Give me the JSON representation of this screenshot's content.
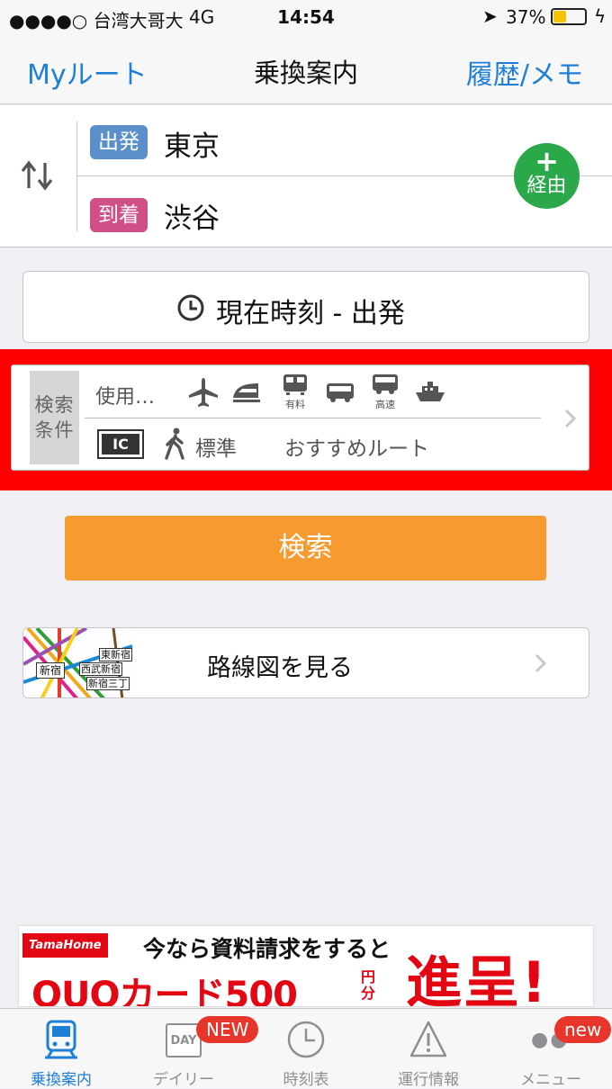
{
  "status": {
    "carrier": "●●●●○ 台湾大哥大",
    "network": "4G",
    "time": "14:54",
    "battery": "37%"
  },
  "nav": {
    "left": "Myルート",
    "title": "乗換案内",
    "right": "履歴/メモ"
  },
  "route": {
    "from_tag": "出発",
    "from_station": "東京",
    "to_tag": "到着",
    "to_station": "渋谷",
    "via_plus": "+",
    "via_label": "経由"
  },
  "time_button": "現在時刻 - 出発",
  "conditions": {
    "label": "検索条件",
    "usage": "使用…",
    "transport_icons": [
      "airplane-icon",
      "shinkansen-icon",
      "limited-express-icon",
      "bus-icon",
      "highway-bus-icon",
      "ferry-icon"
    ],
    "paid_label": "有料",
    "highway_label": "高速",
    "ic_label": "IC",
    "walk_speed": "標準",
    "route_pref": "おすすめルート"
  },
  "search_button": "検索",
  "map_button": {
    "label": "路線図を見る",
    "thumb": [
      "東新宿",
      "新宿",
      "西武新宿",
      "新宿三丁"
    ]
  },
  "ad": {
    "brand": "TamaHome",
    "line1": "今なら資料請求をすると",
    "line2": "QUOカード500",
    "unit": "円分",
    "line3": "進呈!"
  },
  "tabs": [
    {
      "label": "乗換案内",
      "icon": "train-icon",
      "badge": ""
    },
    {
      "label": "デイリー",
      "icon": "calendar-day-icon",
      "badge": "NEW",
      "icon_text": "DAY"
    },
    {
      "label": "時刻表",
      "icon": "clock-icon",
      "badge": ""
    },
    {
      "label": "運行情報",
      "icon": "warning-icon",
      "badge": ""
    },
    {
      "label": "メニュー",
      "icon": "more-icon",
      "badge": "new"
    }
  ],
  "colors": {
    "accent": "#1f7fd6",
    "search": "#f79a30",
    "depart": "#5b8fc9",
    "arrive": "#d04f86",
    "via": "#2aa84a",
    "highlight": "#ff0000"
  }
}
